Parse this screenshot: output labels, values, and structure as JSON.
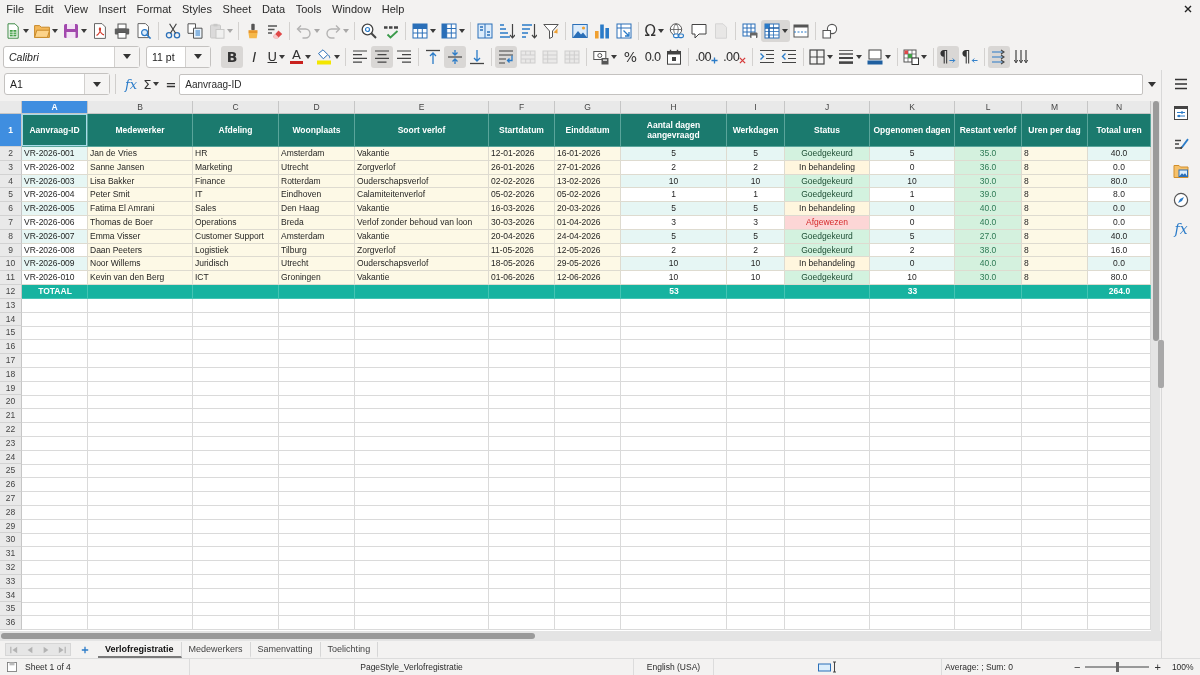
{
  "menu": [
    "File",
    "Edit",
    "View",
    "Insert",
    "Format",
    "Styles",
    "Sheet",
    "Data",
    "Tools",
    "Window",
    "Help"
  ],
  "toolbars": {
    "standard": [
      [
        {
          "kind": "new",
          "dropdown": true,
          "pressed": false,
          "disabled": false
        },
        {
          "kind": "open",
          "dropdown": true,
          "pressed": false,
          "disabled": false
        },
        {
          "kind": "save",
          "dropdown": true,
          "pressed": false,
          "disabled": false
        },
        {
          "kind": "pdf",
          "dropdown": false,
          "pressed": false,
          "disabled": false
        },
        {
          "kind": "print",
          "dropdown": false,
          "pressed": false,
          "disabled": false
        },
        {
          "kind": "preview",
          "dropdown": false,
          "pressed": false,
          "disabled": false
        }
      ],
      [
        {
          "kind": "cut",
          "dropdown": false,
          "pressed": false,
          "disabled": false
        },
        {
          "kind": "copy",
          "dropdown": false,
          "pressed": false,
          "disabled": false
        },
        {
          "kind": "paste",
          "dropdown": true,
          "pressed": false,
          "disabled": true
        }
      ],
      [
        {
          "kind": "clone",
          "dropdown": false,
          "pressed": false,
          "disabled": false
        },
        {
          "kind": "clear",
          "dropdown": false,
          "pressed": false,
          "disabled": false
        }
      ],
      [
        {
          "kind": "undo",
          "dropdown": true,
          "pressed": false,
          "disabled": true
        },
        {
          "kind": "redo",
          "dropdown": true,
          "pressed": false,
          "disabled": true
        }
      ],
      [
        {
          "kind": "find",
          "dropdown": false,
          "pressed": false,
          "disabled": false
        },
        {
          "kind": "spelling",
          "dropdown": false,
          "pressed": false,
          "disabled": false
        }
      ],
      [
        {
          "kind": "rows",
          "dropdown": true,
          "pressed": false,
          "disabled": false
        },
        {
          "kind": "columns",
          "dropdown": true,
          "pressed": false,
          "disabled": false
        }
      ],
      [
        {
          "kind": "sort",
          "dropdown": false,
          "pressed": false,
          "disabled": false
        },
        {
          "kind": "ascending",
          "dropdown": false,
          "pressed": false,
          "disabled": false
        },
        {
          "kind": "descending",
          "dropdown": false,
          "pressed": false,
          "disabled": false
        },
        {
          "kind": "autofilter",
          "dropdown": false,
          "pressed": false,
          "disabled": false
        }
      ],
      [
        {
          "kind": "image",
          "dropdown": false,
          "pressed": false,
          "disabled": false
        },
        {
          "kind": "chart",
          "dropdown": false,
          "pressed": false,
          "disabled": false
        },
        {
          "kind": "pivot",
          "dropdown": false,
          "pressed": false,
          "disabled": false
        }
      ],
      [
        {
          "kind": "symbol",
          "glyph": "Ω",
          "dropdown": true,
          "pressed": false,
          "disabled": false
        },
        {
          "kind": "hyperlink",
          "dropdown": false,
          "pressed": false,
          "disabled": false
        },
        {
          "kind": "comment",
          "dropdown": false,
          "pressed": false,
          "disabled": false
        },
        {
          "kind": "headerfooter",
          "dropdown": false,
          "pressed": false,
          "disabled": true
        }
      ],
      [
        {
          "kind": "printarea",
          "dropdown": false,
          "pressed": false,
          "disabled": false
        },
        {
          "kind": "freeze",
          "dropdown": true,
          "pressed": true,
          "disabled": false
        },
        {
          "kind": "split",
          "dropdown": false,
          "pressed": false,
          "disabled": false
        }
      ],
      [
        {
          "kind": "shapes",
          "dropdown": false,
          "pressed": false,
          "disabled": false
        }
      ]
    ],
    "formatting": {
      "font_name": "Calibri",
      "font_size": "11 pt",
      "groups": [
        [
          {
            "kind": "bold",
            "glyph": "B",
            "dropdown": false,
            "pressed": true,
            "disabled": false
          },
          {
            "kind": "italic",
            "glyph": "I",
            "dropdown": false,
            "pressed": false,
            "disabled": false
          },
          {
            "kind": "underline",
            "glyph": "U",
            "dropdown": true,
            "pressed": false,
            "disabled": false
          },
          {
            "kind": "fontcolor",
            "glyph": "A",
            "dropdown": true,
            "pressed": false,
            "disabled": false
          },
          {
            "kind": "highlight",
            "dropdown": true,
            "pressed": false,
            "disabled": false
          }
        ],
        [
          {
            "kind": "left",
            "dropdown": false,
            "pressed": false,
            "disabled": false
          },
          {
            "kind": "center",
            "dropdown": false,
            "pressed": true,
            "disabled": false
          },
          {
            "kind": "right",
            "dropdown": false,
            "pressed": false,
            "disabled": false
          }
        ],
        [
          {
            "kind": "top",
            "dropdown": false,
            "pressed": false,
            "disabled": false
          },
          {
            "kind": "middle",
            "dropdown": false,
            "pressed": true,
            "disabled": false
          },
          {
            "kind": "bottom",
            "dropdown": false,
            "pressed": false,
            "disabled": false
          }
        ],
        [
          {
            "kind": "wrap",
            "dropdown": false,
            "pressed": true,
            "disabled": false
          },
          {
            "kind": "mergecenter",
            "dropdown": false,
            "pressed": false,
            "disabled": true
          },
          {
            "kind": "merge",
            "dropdown": false,
            "pressed": false,
            "disabled": true
          },
          {
            "kind": "unmerge",
            "dropdown": false,
            "pressed": false,
            "disabled": true
          }
        ],
        [
          {
            "kind": "currency",
            "dropdown": true,
            "pressed": false,
            "disabled": false
          },
          {
            "kind": "percent",
            "glyph": "%",
            "dropdown": false,
            "pressed": false,
            "disabled": false
          },
          {
            "kind": "number",
            "glyph": "0.0",
            "dropdown": false,
            "pressed": false,
            "disabled": false
          },
          {
            "kind": "date",
            "dropdown": false,
            "pressed": false,
            "disabled": false
          }
        ],
        [
          {
            "kind": "adddecimal",
            "glyph": ".00",
            "dropdown": false,
            "pressed": false,
            "disabled": false
          },
          {
            "kind": "deldecimal",
            "glyph": ".00",
            "dropdown": false,
            "pressed": false,
            "disabled": false
          }
        ],
        [
          {
            "kind": "indent",
            "dropdown": false,
            "pressed": false,
            "disabled": false
          },
          {
            "kind": "outdent",
            "dropdown": false,
            "pressed": false,
            "disabled": false
          }
        ],
        [
          {
            "kind": "borders",
            "dropdown": true,
            "pressed": false,
            "disabled": false
          },
          {
            "kind": "borderstyle",
            "dropdown": true,
            "pressed": false,
            "disabled": false
          },
          {
            "kind": "bordercolor",
            "dropdown": true,
            "pressed": false,
            "disabled": false
          }
        ],
        [
          {
            "kind": "conditional",
            "dropdown": true,
            "pressed": false,
            "disabled": false
          }
        ],
        [
          {
            "kind": "ltr",
            "glyph": "¶",
            "dropdown": false,
            "pressed": true,
            "disabled": false
          },
          {
            "kind": "rtl",
            "glyph": "¶",
            "dropdown": false,
            "pressed": false,
            "disabled": false
          }
        ],
        [
          {
            "kind": "horizontal",
            "dropdown": false,
            "pressed": true,
            "disabled": false
          },
          {
            "kind": "vertical",
            "dropdown": false,
            "pressed": false,
            "disabled": false
          }
        ]
      ]
    }
  },
  "formula_bar": {
    "cell_reference": "A1",
    "function_wizard": "fx",
    "sum": "Σ",
    "formula": "=",
    "content": "Aanvraag-ID"
  },
  "sheet": {
    "column_headers": [
      {
        "label": "A",
        "selected": true
      },
      {
        "label": "B",
        "selected": false
      },
      {
        "label": "C",
        "selected": false
      },
      {
        "label": "D",
        "selected": false
      },
      {
        "label": "E",
        "selected": false
      },
      {
        "label": "F",
        "selected": false
      },
      {
        "label": "G",
        "selected": false
      },
      {
        "label": "H",
        "selected": false
      },
      {
        "label": "I",
        "selected": false
      },
      {
        "label": "J",
        "selected": false
      },
      {
        "label": "K",
        "selected": false
      },
      {
        "label": "L",
        "selected": false
      },
      {
        "label": "M",
        "selected": false
      },
      {
        "label": "N",
        "selected": false
      }
    ],
    "row_headers": [
      {
        "label": "1",
        "selected": true
      },
      {
        "label": "2",
        "selected": false
      },
      {
        "label": "3",
        "selected": false
      },
      {
        "label": "4",
        "selected": false
      },
      {
        "label": "5",
        "selected": false
      },
      {
        "label": "6",
        "selected": false
      },
      {
        "label": "7",
        "selected": false
      },
      {
        "label": "8",
        "selected": false
      },
      {
        "label": "9",
        "selected": false
      },
      {
        "label": "10",
        "selected": false
      },
      {
        "label": "11",
        "selected": false
      },
      {
        "label": "12",
        "selected": false
      },
      {
        "label": "13",
        "selected": false
      },
      {
        "label": "14",
        "selected": false
      },
      {
        "label": "15",
        "selected": false
      },
      {
        "label": "16",
        "selected": false
      },
      {
        "label": "17",
        "selected": false
      },
      {
        "label": "18",
        "selected": false
      },
      {
        "label": "19",
        "selected": false
      },
      {
        "label": "20",
        "selected": false
      },
      {
        "label": "21",
        "selected": false
      },
      {
        "label": "22",
        "selected": false
      },
      {
        "label": "23",
        "selected": false
      },
      {
        "label": "24",
        "selected": false
      },
      {
        "label": "25",
        "selected": false
      },
      {
        "label": "26",
        "selected": false
      },
      {
        "label": "27",
        "selected": false
      },
      {
        "label": "28",
        "selected": false
      },
      {
        "label": "29",
        "selected": false
      },
      {
        "label": "30",
        "selected": false
      },
      {
        "label": "31",
        "selected": false
      },
      {
        "label": "32",
        "selected": false
      },
      {
        "label": "33",
        "selected": false
      },
      {
        "label": "34",
        "selected": false
      },
      {
        "label": "35",
        "selected": false
      },
      {
        "label": "36",
        "selected": false
      }
    ],
    "header_row": [
      "Aanvraag-ID",
      "Medewerker",
      "Afdeling",
      "Woonplaats",
      "Soort verlof",
      "Startdatum",
      "Einddatum",
      "Aantal dagen aangevraagd",
      "Werkdagen",
      "Status",
      "Opgenomen dagen",
      "Restant verlof",
      "Uren per dag",
      "Totaal uren"
    ],
    "data_rows": [
      {
        "kind": "approved",
        "cells": [
          "VR-2026-001",
          "Jan de Vries",
          "HR",
          "Amsterdam",
          "Vakantie",
          "12-01-2026",
          "16-01-2026",
          "5",
          "5",
          "Goedgekeurd",
          "5",
          "35.0",
          "8",
          "40.0"
        ]
      },
      {
        "kind": "pending",
        "cells": [
          "VR-2026-002",
          "Sanne Jansen",
          "Marketing",
          "Utrecht",
          "Zorgverlof",
          "26-01-2026",
          "27-01-2026",
          "2",
          "2",
          "In behandeling",
          "0",
          "36.0",
          "8",
          "0.0"
        ]
      },
      {
        "kind": "approved",
        "cells": [
          "VR-2026-003",
          "Lisa Bakker",
          "Finance",
          "Rotterdam",
          "Ouderschapsverlof",
          "02-02-2026",
          "13-02-2026",
          "10",
          "10",
          "Goedgekeurd",
          "10",
          "30.0",
          "8",
          "80.0"
        ]
      },
      {
        "kind": "approved",
        "cells": [
          "VR-2026-004",
          "Peter Smit",
          "IT",
          "Eindhoven",
          "Calamiteitenverlof",
          "05-02-2026",
          "05-02-2026",
          "1",
          "1",
          "Goedgekeurd",
          "1",
          "39.0",
          "8",
          "8.0"
        ]
      },
      {
        "kind": "pending",
        "cells": [
          "VR-2026-005",
          "Fatima El Amrani",
          "Sales",
          "Den Haag",
          "Vakantie",
          "16-03-2026",
          "20-03-2026",
          "5",
          "5",
          "In behandeling",
          "0",
          "40.0",
          "8",
          "0.0"
        ]
      },
      {
        "kind": "rejected",
        "cells": [
          "VR-2026-006",
          "Thomas de Boer",
          "Operations",
          "Breda",
          "Verlof zonder behoud van loon",
          "30-03-2026",
          "01-04-2026",
          "3",
          "3",
          "Afgewezen",
          "0",
          "40.0",
          "8",
          "0.0"
        ]
      },
      {
        "kind": "approved",
        "cells": [
          "VR-2026-007",
          "Emma Visser",
          "Customer Support",
          "Amsterdam",
          "Vakantie",
          "20-04-2026",
          "24-04-2026",
          "5",
          "5",
          "Goedgekeurd",
          "5",
          "27.0",
          "8",
          "40.0"
        ]
      },
      {
        "kind": "approved",
        "cells": [
          "VR-2026-008",
          "Daan Peeters",
          "Logistiek",
          "Tilburg",
          "Zorgverlof",
          "11-05-2026",
          "12-05-2026",
          "2",
          "2",
          "Goedgekeurd",
          "2",
          "38.0",
          "8",
          "16.0"
        ]
      },
      {
        "kind": "pending",
        "cells": [
          "VR-2026-009",
          "Noor Willems",
          "Juridisch",
          "Utrecht",
          "Ouderschapsverlof",
          "18-05-2026",
          "29-05-2026",
          "10",
          "10",
          "In behandeling",
          "0",
          "40.0",
          "8",
          "0.0"
        ]
      },
      {
        "kind": "approved",
        "cells": [
          "VR-2026-010",
          "Kevin van den Berg",
          "ICT",
          "Groningen",
          "Vakantie",
          "01-06-2026",
          "12-06-2026",
          "10",
          "10",
          "Goedgekeurd",
          "10",
          "30.0",
          "8",
          "80.0"
        ]
      }
    ],
    "total_row": {
      "label": "TOTAAL",
      "requested_days": "53",
      "taken_days": "33",
      "total_hours": "264.0"
    }
  },
  "sheet_nav": [
    {
      "kind": "first",
      "disabled": true
    },
    {
      "kind": "previous",
      "disabled": true
    },
    {
      "kind": "next",
      "disabled": true
    },
    {
      "kind": "last",
      "disabled": true
    }
  ],
  "sheet_tabs": [
    {
      "label": "Verlofregistratie",
      "selected": true
    },
    {
      "label": "Medewerkers",
      "selected": false
    },
    {
      "label": "Samenvatting",
      "selected": false
    },
    {
      "label": "Toelichting",
      "selected": false
    }
  ],
  "sidebar": {
    "functions": "fx"
  },
  "status_bar": {
    "sheet": "Sheet 1 of 4",
    "page_style": "PageStyle_Verlofregistratie",
    "language": "English (USA)",
    "selection": "Average: ; Sum: 0",
    "zoom": {
      "out": "−",
      "level": 0.5,
      "in": "+",
      "label": "100%"
    }
  }
}
